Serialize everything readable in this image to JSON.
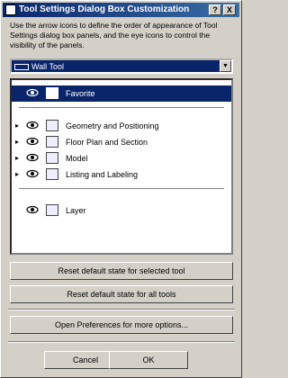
{
  "window": {
    "title": "Tool Settings Dialog Box Customization",
    "help_label": "?",
    "close_label": "X"
  },
  "description": "Use the arrow icons to define the order of appearance of Tool Settings dialog box panels, and the eye icons to control the visibility of the panels.",
  "tool_select": {
    "value": "Wall Tool",
    "icon": "wall-tool-icon"
  },
  "panels": [
    {
      "label": "Favorite",
      "selected": true,
      "has_arrow": false,
      "icon": "star-icon"
    },
    {
      "label": "Geometry and Positioning",
      "selected": false,
      "has_arrow": true,
      "icon": "geometry-icon"
    },
    {
      "label": "Floor Plan and Section",
      "selected": false,
      "has_arrow": true,
      "icon": "floor-plan-icon"
    },
    {
      "label": "Model",
      "selected": false,
      "has_arrow": true,
      "icon": "model-icon"
    },
    {
      "label": "Listing and Labeling",
      "selected": false,
      "has_arrow": true,
      "icon": "listing-icon"
    },
    {
      "label": "Layer",
      "selected": false,
      "has_arrow": false,
      "icon": "layer-icon"
    }
  ],
  "buttons": {
    "reset_selected": "Reset default state for selected tool",
    "reset_all": "Reset default state for all tools",
    "open_prefs": "Open Preferences for more options...",
    "cancel": "Cancel",
    "ok": "OK"
  }
}
